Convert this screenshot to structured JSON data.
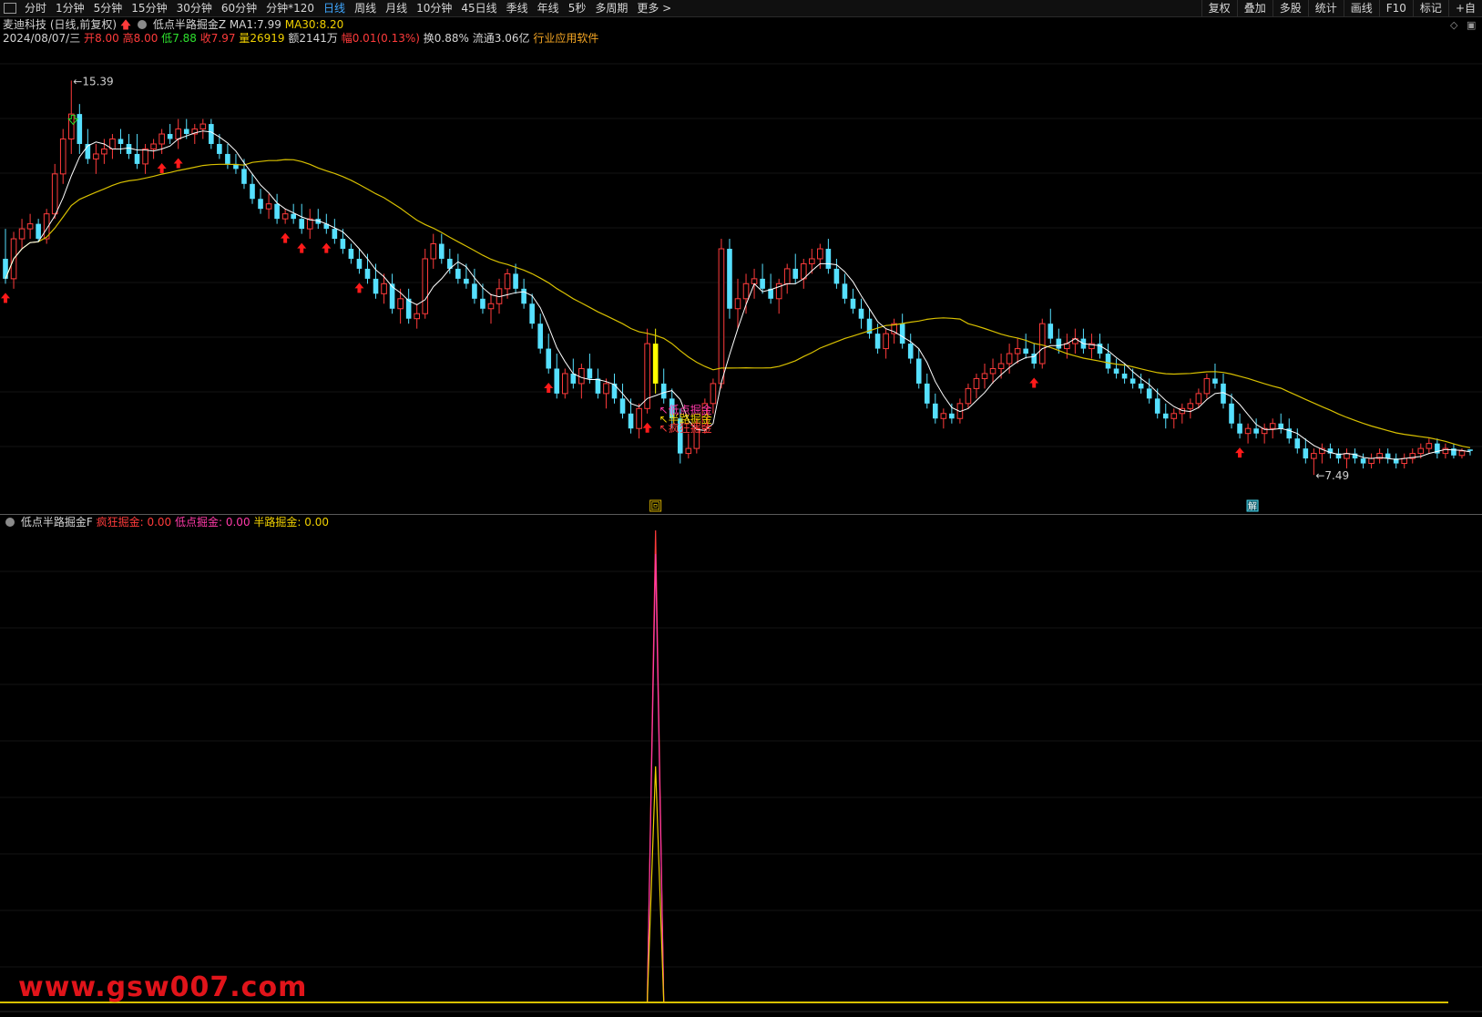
{
  "toolbar": {
    "periods": [
      "分时",
      "1分钟",
      "5分钟",
      "15分钟",
      "30分钟",
      "60分钟",
      "分钟*120",
      "日线",
      "周线",
      "月线",
      "10分钟",
      "45日线",
      "季线",
      "年线",
      "5秒",
      "多周期",
      "更多 >"
    ],
    "active_period": "日线",
    "tools": [
      "复权",
      "叠加",
      "多股",
      "统计",
      "画线",
      "F10",
      "标记",
      "+自"
    ]
  },
  "info": {
    "stock_name": "麦迪科技",
    "chart_mode": "(日线,前复权)",
    "indicator_name": "低点半路掘金Z",
    "ma1_label": "MA1:",
    "ma1_value": "7.99",
    "ma30_label": "MA30:",
    "ma30_value": "8.20",
    "date": "2024/08/07/三",
    "open_label": "开",
    "open_value": "8.00",
    "high_label": "高",
    "high_value": "8.00",
    "low_label": "低",
    "low_value": "7.88",
    "close_label": "收",
    "close_value": "7.97",
    "volume_label": "量",
    "volume_value": "26919",
    "amount_label": "额",
    "amount_value": "2141万",
    "change_label": "幅",
    "change_value": "0.01(0.13%)",
    "turnover_label": "换",
    "turnover_value": "0.88%",
    "float_label": "流通",
    "float_value": "3.06亿",
    "industry": "行业应用软件"
  },
  "sub_info": {
    "indicator_name": "低点半路掘金F",
    "s1_label": "疯狂掘金:",
    "s1_value": "0.00",
    "s2_label": "低点掘金:",
    "s2_value": "0.00",
    "s3_label": "半路掘金:",
    "s3_value": "0.00"
  },
  "watermark": "www.gsw007.com",
  "chart_data": [
    {
      "type": "candlestick",
      "title": "",
      "series": [
        {
          "name": "MA1",
          "color": "#ffffff"
        },
        {
          "name": "MA30",
          "color": "#d8c000"
        }
      ],
      "colors": {
        "up": "#ff3b3b",
        "down": "#56e0ff",
        "signal_bar": "#ffff00",
        "up_arrow": "#ff1a1a",
        "down_arrow": "#2ee02e"
      },
      "high_label": "15.39",
      "low_label": "7.49",
      "signal_labels": [
        "低点掘金",
        "半路掘金",
        "疯狂掘金"
      ],
      "signal_label_colors": [
        "#ff3aa8",
        "#f0d000",
        "#ff3b3b"
      ],
      "marker_boxes": [
        "回",
        "解"
      ],
      "ylim": [
        7.0,
        16.0
      ],
      "ohlc": [
        [
          11.82,
          12.42,
          11.32,
          11.42
        ],
        [
          11.42,
          12.36,
          11.22,
          12.22
        ],
        [
          12.22,
          12.62,
          12.02,
          12.42
        ],
        [
          12.42,
          12.72,
          12.22,
          12.52
        ],
        [
          12.52,
          12.62,
          12.17,
          12.22
        ],
        [
          12.22,
          12.82,
          12.12,
          12.72
        ],
        [
          12.72,
          13.72,
          12.62,
          13.52
        ],
        [
          13.52,
          14.42,
          13.32,
          14.22
        ],
        [
          14.22,
          15.39,
          13.92,
          14.72
        ],
        [
          14.72,
          14.92,
          13.92,
          14.12
        ],
        [
          14.12,
          14.42,
          13.72,
          13.82
        ],
        [
          13.82,
          14.12,
          13.52,
          13.92
        ],
        [
          13.92,
          14.22,
          13.72,
          14.02
        ],
        [
          14.02,
          14.32,
          13.82,
          14.22
        ],
        [
          14.22,
          14.42,
          13.92,
          14.12
        ],
        [
          14.12,
          14.32,
          13.82,
          13.92
        ],
        [
          13.92,
          14.32,
          13.62,
          13.72
        ],
        [
          13.72,
          14.12,
          13.52,
          14.02
        ],
        [
          14.02,
          14.22,
          13.82,
          14.12
        ],
        [
          14.12,
          14.42,
          13.92,
          14.32
        ],
        [
          14.32,
          14.52,
          14.12,
          14.22
        ],
        [
          14.22,
          14.62,
          14.02,
          14.42
        ],
        [
          14.42,
          14.62,
          14.22,
          14.32
        ],
        [
          14.32,
          14.52,
          14.12,
          14.42
        ],
        [
          14.42,
          14.62,
          14.22,
          14.52
        ],
        [
          14.52,
          14.62,
          14.02,
          14.12
        ],
        [
          14.12,
          14.32,
          13.82,
          13.92
        ],
        [
          13.92,
          14.12,
          13.62,
          13.72
        ],
        [
          13.72,
          13.92,
          13.52,
          13.62
        ],
        [
          13.62,
          13.82,
          13.22,
          13.32
        ],
        [
          13.32,
          13.52,
          12.92,
          13.02
        ],
        [
          13.02,
          13.22,
          12.72,
          12.82
        ],
        [
          12.82,
          13.12,
          12.62,
          12.92
        ],
        [
          12.92,
          13.12,
          12.52,
          12.62
        ],
        [
          12.62,
          12.82,
          12.52,
          12.72
        ],
        [
          12.72,
          12.92,
          12.52,
          12.62
        ],
        [
          12.62,
          12.92,
          12.32,
          12.42
        ],
        [
          12.42,
          12.82,
          12.22,
          12.62
        ],
        [
          12.62,
          12.82,
          12.42,
          12.52
        ],
        [
          12.52,
          12.72,
          12.32,
          12.42
        ],
        [
          12.42,
          12.62,
          12.12,
          12.22
        ],
        [
          12.22,
          12.42,
          11.92,
          12.02
        ],
        [
          12.02,
          12.12,
          11.72,
          11.82
        ],
        [
          11.82,
          12.02,
          11.52,
          11.62
        ],
        [
          11.62,
          11.92,
          11.32,
          11.42
        ],
        [
          11.42,
          11.72,
          11.02,
          11.12
        ],
        [
          11.12,
          11.52,
          10.92,
          11.32
        ],
        [
          11.32,
          11.52,
          10.72,
          10.82
        ],
        [
          10.82,
          11.22,
          10.52,
          11.02
        ],
        [
          11.02,
          11.22,
          10.52,
          10.62
        ],
        [
          10.62,
          10.92,
          10.42,
          10.72
        ],
        [
          10.72,
          12.02,
          10.62,
          11.82
        ],
        [
          11.82,
          12.32,
          11.62,
          12.12
        ],
        [
          12.12,
          12.32,
          11.72,
          11.82
        ],
        [
          11.82,
          12.02,
          11.52,
          11.62
        ],
        [
          11.62,
          11.92,
          11.32,
          11.42
        ],
        [
          11.42,
          11.72,
          11.22,
          11.32
        ],
        [
          11.32,
          11.62,
          10.92,
          11.02
        ],
        [
          11.02,
          11.32,
          10.72,
          10.82
        ],
        [
          10.82,
          11.12,
          10.52,
          10.92
        ],
        [
          10.92,
          11.42,
          10.72,
          11.22
        ],
        [
          11.22,
          11.62,
          11.02,
          11.52
        ],
        [
          11.52,
          11.72,
          11.12,
          11.22
        ],
        [
          11.22,
          11.42,
          10.82,
          10.92
        ],
        [
          10.92,
          11.12,
          10.42,
          10.52
        ],
        [
          10.52,
          10.72,
          9.92,
          10.02
        ],
        [
          10.02,
          10.32,
          9.52,
          9.62
        ],
        [
          9.62,
          9.92,
          9.02,
          9.12
        ],
        [
          9.12,
          9.62,
          9.02,
          9.52
        ],
        [
          9.52,
          9.82,
          9.22,
          9.32
        ],
        [
          9.32,
          9.72,
          9.02,
          9.62
        ],
        [
          9.62,
          9.92,
          9.32,
          9.42
        ],
        [
          9.42,
          9.62,
          9.02,
          9.12
        ],
        [
          9.12,
          9.42,
          8.82,
          9.32
        ],
        [
          9.32,
          9.52,
          8.92,
          9.02
        ],
        [
          9.02,
          9.32,
          8.62,
          8.72
        ],
        [
          8.72,
          9.02,
          8.32,
          8.42
        ],
        [
          8.42,
          8.92,
          8.22,
          8.82
        ],
        [
          8.82,
          10.42,
          8.72,
          10.12
        ],
        [
          10.12,
          10.42,
          9.12,
          9.32
        ],
        [
          9.32,
          9.62,
          8.92,
          9.02
        ],
        [
          9.02,
          9.22,
          8.42,
          8.62
        ],
        [
          8.62,
          8.82,
          7.72,
          7.92
        ],
        [
          7.92,
          8.32,
          7.82,
          8.02
        ],
        [
          8.02,
          8.62,
          7.92,
          8.42
        ],
        [
          8.42,
          9.02,
          8.32,
          8.92
        ],
        [
          8.92,
          9.42,
          8.72,
          9.32
        ],
        [
          9.32,
          12.22,
          9.22,
          12.02
        ],
        [
          12.02,
          12.22,
          10.62,
          10.82
        ],
        [
          10.82,
          11.42,
          10.42,
          11.02
        ],
        [
          11.02,
          11.52,
          10.72,
          11.32
        ],
        [
          11.32,
          11.62,
          11.02,
          11.42
        ],
        [
          11.42,
          11.72,
          11.12,
          11.22
        ],
        [
          11.22,
          11.52,
          10.92,
          11.02
        ],
        [
          11.02,
          11.42,
          10.72,
          11.32
        ],
        [
          11.32,
          11.72,
          11.12,
          11.62
        ],
        [
          11.62,
          11.92,
          11.32,
          11.42
        ],
        [
          11.42,
          11.82,
          11.22,
          11.72
        ],
        [
          11.72,
          12.02,
          11.52,
          11.82
        ],
        [
          11.82,
          12.12,
          11.62,
          12.02
        ],
        [
          12.02,
          12.22,
          11.52,
          11.62
        ],
        [
          11.62,
          11.82,
          11.22,
          11.32
        ],
        [
          11.32,
          11.52,
          10.92,
          11.02
        ],
        [
          11.02,
          11.22,
          10.72,
          10.82
        ],
        [
          10.82,
          11.02,
          10.42,
          10.62
        ],
        [
          10.62,
          10.82,
          10.22,
          10.32
        ],
        [
          10.32,
          10.52,
          9.92,
          10.02
        ],
        [
          10.02,
          10.42,
          9.82,
          10.32
        ],
        [
          10.32,
          10.62,
          10.12,
          10.52
        ],
        [
          10.52,
          10.72,
          10.02,
          10.12
        ],
        [
          10.12,
          10.32,
          9.72,
          9.82
        ],
        [
          9.82,
          10.02,
          9.22,
          9.32
        ],
        [
          9.32,
          9.52,
          8.82,
          8.92
        ],
        [
          8.92,
          9.12,
          8.52,
          8.62
        ],
        [
          8.62,
          8.82,
          8.42,
          8.72
        ],
        [
          8.72,
          8.92,
          8.52,
          8.62
        ],
        [
          8.62,
          9.02,
          8.52,
          8.92
        ],
        [
          8.92,
          9.32,
          8.82,
          9.22
        ],
        [
          9.22,
          9.52,
          9.02,
          9.42
        ],
        [
          9.42,
          9.72,
          9.22,
          9.52
        ],
        [
          9.52,
          9.82,
          9.32,
          9.62
        ],
        [
          9.62,
          9.92,
          9.42,
          9.72
        ],
        [
          9.72,
          10.12,
          9.52,
          9.92
        ],
        [
          9.92,
          10.22,
          9.72,
          10.02
        ],
        [
          10.02,
          10.32,
          9.82,
          9.92
        ],
        [
          9.92,
          10.12,
          9.62,
          9.72
        ],
        [
          9.72,
          10.62,
          9.62,
          10.52
        ],
        [
          10.52,
          10.82,
          10.12,
          10.22
        ],
        [
          10.22,
          10.42,
          9.92,
          10.02
        ],
        [
          10.02,
          10.32,
          9.82,
          10.12
        ],
        [
          10.12,
          10.42,
          9.92,
          10.22
        ],
        [
          10.22,
          10.42,
          9.92,
          10.02
        ],
        [
          10.02,
          10.32,
          9.82,
          10.12
        ],
        [
          10.12,
          10.32,
          9.82,
          9.92
        ],
        [
          9.92,
          10.12,
          9.52,
          9.62
        ],
        [
          9.62,
          9.82,
          9.42,
          9.52
        ],
        [
          9.52,
          9.72,
          9.32,
          9.42
        ],
        [
          9.42,
          9.62,
          9.22,
          9.32
        ],
        [
          9.32,
          9.52,
          9.12,
          9.22
        ],
        [
          9.22,
          9.42,
          8.92,
          9.02
        ],
        [
          9.02,
          9.22,
          8.62,
          8.72
        ],
        [
          8.72,
          8.92,
          8.42,
          8.62
        ],
        [
          8.62,
          8.82,
          8.42,
          8.72
        ],
        [
          8.72,
          8.92,
          8.52,
          8.82
        ],
        [
          8.82,
          9.02,
          8.62,
          8.92
        ],
        [
          8.92,
          9.22,
          8.82,
          9.12
        ],
        [
          9.12,
          9.52,
          9.02,
          9.42
        ],
        [
          9.42,
          9.72,
          9.22,
          9.32
        ],
        [
          9.32,
          9.52,
          8.82,
          8.92
        ],
        [
          8.92,
          9.12,
          8.42,
          8.52
        ],
        [
          8.52,
          8.72,
          8.22,
          8.32
        ],
        [
          8.32,
          8.52,
          8.12,
          8.42
        ],
        [
          8.42,
          8.62,
          8.22,
          8.32
        ],
        [
          8.32,
          8.52,
          8.12,
          8.42
        ],
        [
          8.42,
          8.62,
          8.22,
          8.52
        ],
        [
          8.52,
          8.72,
          8.32,
          8.42
        ],
        [
          8.42,
          8.62,
          8.12,
          8.22
        ],
        [
          8.22,
          8.42,
          7.92,
          8.02
        ],
        [
          8.02,
          8.22,
          7.72,
          7.82
        ],
        [
          7.82,
          8.02,
          7.49,
          7.92
        ],
        [
          7.92,
          8.12,
          7.72,
          8.02
        ],
        [
          8.02,
          8.12,
          7.82,
          7.92
        ],
        [
          7.92,
          8.02,
          7.72,
          7.82
        ],
        [
          7.82,
          8.02,
          7.62,
          7.92
        ],
        [
          7.92,
          8.02,
          7.72,
          7.82
        ],
        [
          7.82,
          7.92,
          7.62,
          7.72
        ],
        [
          7.72,
          7.92,
          7.62,
          7.82
        ],
        [
          7.82,
          8.02,
          7.72,
          7.92
        ],
        [
          7.92,
          8.02,
          7.72,
          7.82
        ],
        [
          7.82,
          7.92,
          7.62,
          7.72
        ],
        [
          7.72,
          7.92,
          7.62,
          7.82
        ],
        [
          7.82,
          8.02,
          7.72,
          7.92
        ],
        [
          7.92,
          8.12,
          7.82,
          8.02
        ],
        [
          8.02,
          8.22,
          7.92,
          8.12
        ],
        [
          8.12,
          8.22,
          7.82,
          7.92
        ],
        [
          7.92,
          8.12,
          7.82,
          8.02
        ],
        [
          8.02,
          8.12,
          7.82,
          7.88
        ],
        [
          7.88,
          8.02,
          7.82,
          7.97
        ],
        [
          8.0,
          8.0,
          7.88,
          7.97
        ]
      ],
      "signal_index": 79,
      "up_arrow_indices": [
        0,
        19,
        21,
        34,
        36,
        39,
        43,
        66,
        78,
        125,
        150
      ],
      "down_arrow_indices": [
        8
      ]
    },
    {
      "type": "line",
      "title": "",
      "series": [
        {
          "name": "疯狂掘金",
          "color": "#ff3b3b"
        },
        {
          "name": "低点掘金",
          "color": "#ff3aa8"
        },
        {
          "name": "半路掘金",
          "color": "#f0d000"
        }
      ],
      "spike_index": 79,
      "spike_values": [
        1.0,
        0.95,
        0.5
      ],
      "ylim": [
        0,
        1.0
      ]
    }
  ]
}
